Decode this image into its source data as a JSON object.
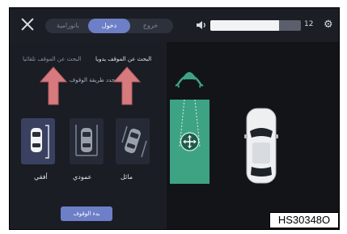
{
  "header": {
    "tabs": [
      {
        "label": "بانورامية",
        "active": false
      },
      {
        "label": "دخول",
        "active": true
      },
      {
        "label": "خروج",
        "active": false
      }
    ],
    "volume": {
      "value": "12",
      "fill_fraction": 0.76
    },
    "icons": {
      "close": "close-icon",
      "volume": "speaker-icon",
      "settings": "gear-icon"
    }
  },
  "search": {
    "auto_label": "البحث عن الموقف تلقائيا",
    "manual_label": "البحث عن الموقف يدويا",
    "choose_label": "حدد طريقة الوقوف"
  },
  "parking_modes": [
    {
      "label": "أفقي",
      "selected": true,
      "icon": "parallel-parking-icon"
    },
    {
      "label": "عمودي",
      "selected": false,
      "icon": "perpendicular-parking-icon"
    },
    {
      "label": "مائل",
      "selected": false,
      "icon": "angled-parking-icon"
    }
  ],
  "start_button": "بدء الوقوف",
  "reference": "HS30348O",
  "colors": {
    "accent": "#6d7fc6",
    "slot": "#3da383",
    "arrow": "#d67a7d"
  }
}
